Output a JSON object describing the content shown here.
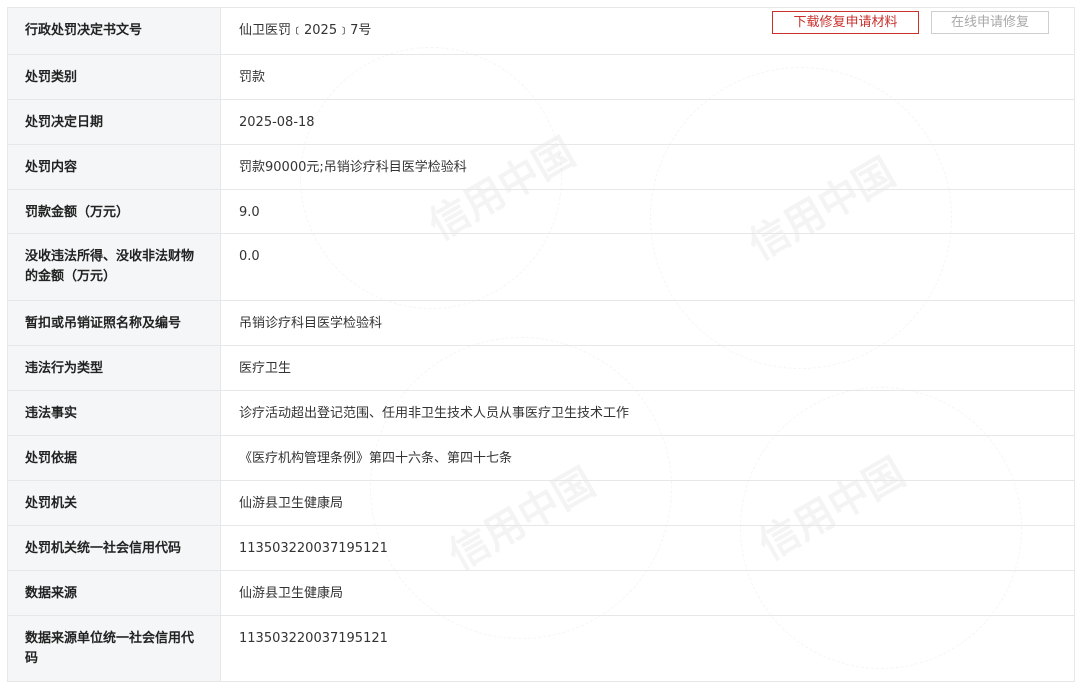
{
  "actions": {
    "download_label": "下载修复申请材料",
    "online_label": "在线申请修复"
  },
  "watermark": "信用中国",
  "rows": [
    {
      "label": "行政处罚决定书文号",
      "value": "仙卫医罚﹝2025﹞7号"
    },
    {
      "label": "处罚类别",
      "value": "罚款"
    },
    {
      "label": "处罚决定日期",
      "value": "2025-08-18"
    },
    {
      "label": "处罚内容",
      "value": "罚款90000元;吊销诊疗科目医学检验科"
    },
    {
      "label": "罚款金额（万元）",
      "value": "9.0"
    },
    {
      "label": "没收违法所得、没收非法财物的金额（万元）",
      "value": "0.0"
    },
    {
      "label": "暂扣或吊销证照名称及编号",
      "value": "吊销诊疗科目医学检验科"
    },
    {
      "label": "违法行为类型",
      "value": "医疗卫生"
    },
    {
      "label": "违法事实",
      "value": "诊疗活动超出登记范围、任用非卫生技术人员从事医疗卫生技术工作"
    },
    {
      "label": "处罚依据",
      "value": "《医疗机构管理条例》第四十六条、第四十七条"
    },
    {
      "label": "处罚机关",
      "value": "仙游县卫生健康局"
    },
    {
      "label": "处罚机关统一社会信用代码",
      "value": "113503220037195121"
    },
    {
      "label": "数据来源",
      "value": "仙游县卫生健康局"
    },
    {
      "label": "数据来源单位统一社会信用代码",
      "value": "113503220037195121"
    }
  ]
}
